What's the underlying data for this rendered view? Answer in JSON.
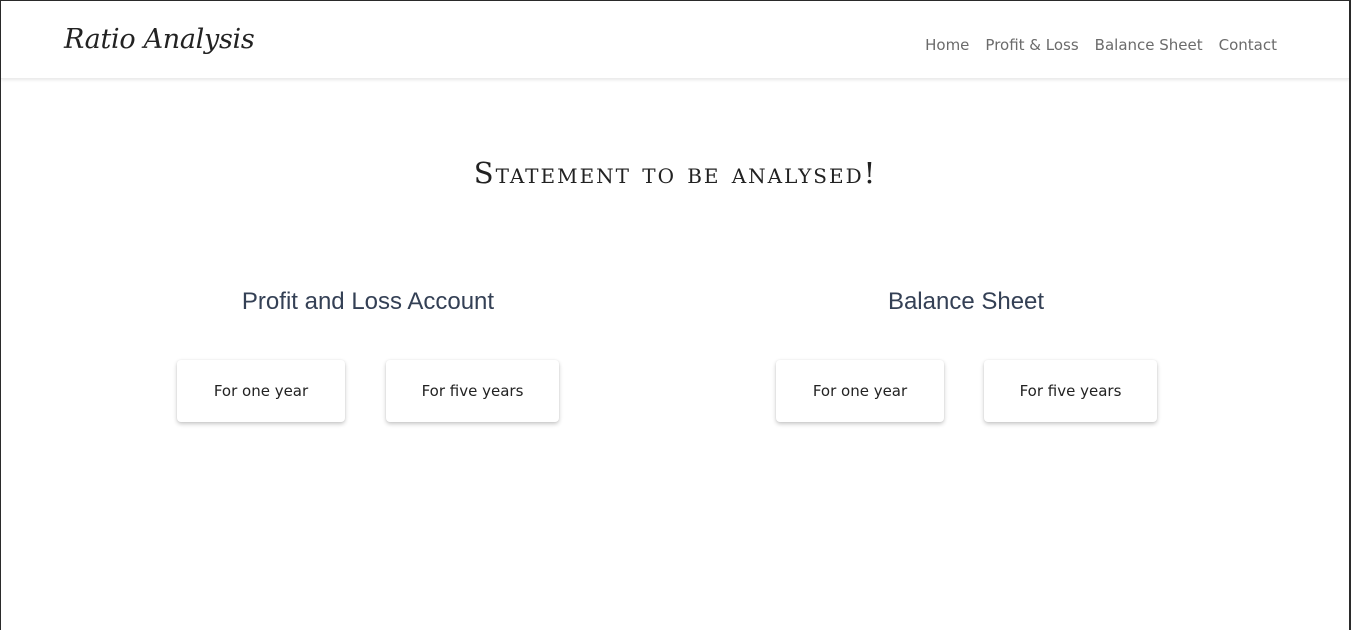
{
  "navbar": {
    "brand": "Ratio Analysis",
    "links": [
      {
        "label": "Home"
      },
      {
        "label": "Profit & Loss"
      },
      {
        "label": "Balance Sheet"
      },
      {
        "label": "Contact"
      }
    ]
  },
  "main": {
    "heading": "Statement to be analysed!",
    "sections": [
      {
        "title": "Profit and Loss Account",
        "buttons": [
          {
            "label": "For one year"
          },
          {
            "label": "For five years"
          }
        ]
      },
      {
        "title": "Balance Sheet",
        "buttons": [
          {
            "label": "For one year"
          },
          {
            "label": "For five years"
          }
        ]
      }
    ]
  },
  "colors": {
    "section_title": "#344055",
    "nav_link": "#6b6b6b",
    "text": "#222222",
    "background": "#ffffff"
  }
}
